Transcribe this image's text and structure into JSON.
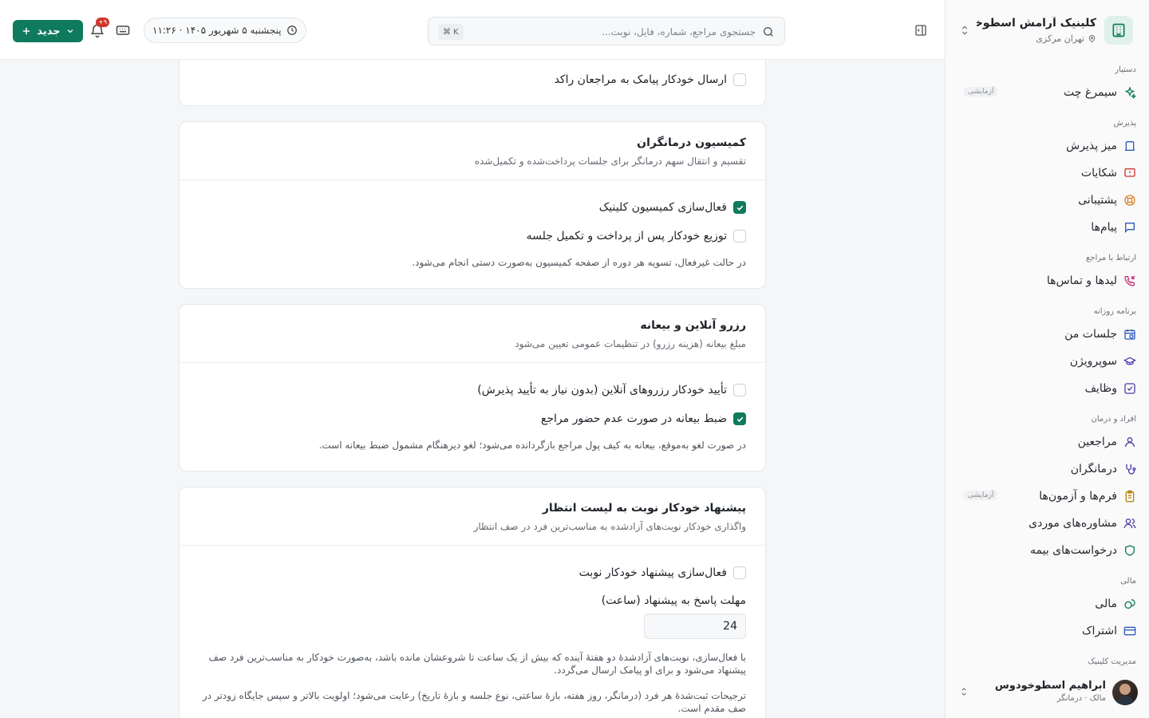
{
  "sidebar": {
    "brand_name": "کلینیک آرامش اسطوخو...",
    "brand_location": "تهران مرکزی",
    "groups": {
      "assistant": "دستیار",
      "reception": "پذیرش",
      "client_contact": "ارتباط با مراجع",
      "daily": "برنامه روزانه",
      "people": "افراد و درمان",
      "finance": "مالی",
      "clinic": "مدیریت کلینیک"
    },
    "items": {
      "simorgh": "سیمرغ چت",
      "reception_desk": "میز پذیرش",
      "complaints": "شکایات",
      "support": "پشتیبانی",
      "messages": "پیام‌ها",
      "leads": "لیدها و تماس‌ها",
      "my_sessions": "جلسات من",
      "supervision": "سوپرویژن",
      "tasks": "وظایف",
      "clients": "مراجعین",
      "therapists": "درمانگران",
      "forms": "فرم‌ها و آزمون‌ها",
      "case_consult": "مشاوره‌های موردی",
      "insurance": "درخواست‌های بیمه",
      "finance": "مالی",
      "subscription": "اشتراک"
    },
    "beta_label": "آزمایشی",
    "user": {
      "name": "ابراهیم اسطوخودوس",
      "role": "مالک · درمانگر"
    }
  },
  "topbar": {
    "search_placeholder": "جستجوی مراجع، شماره، فایل، نوبت...",
    "search_shortcut": "⌘ K",
    "date": "پنجشنبه ۵ شهریور ۱۴۰۵ · ۱۱:۲۶",
    "notifications_count": "۹+",
    "new_label": "جدید"
  },
  "cards": {
    "sms": {
      "label": "ارسال خودکار پیامک به مراجعان راکد",
      "checked": false
    },
    "commission": {
      "title": "کمیسیون درمانگران",
      "subtitle": "تقسیم و انتقال سهم درمانگر برای جلسات پرداخت‌شده و تکمیل‌شده",
      "opt1": "فعال‌سازی کمیسیون کلینیک",
      "opt2": "توزیع خودکار پس از پرداخت و تکمیل جلسه",
      "note": "در حالت غیرفعال، تسویه هر دوره از صفحه کمیسیون به‌صورت دستی انجام می‌شود."
    },
    "booking": {
      "title": "رزرو آنلاین و بیعانه",
      "subtitle": "مبلغ بیعانه (هزینه رزرو) در تنظیمات عمومی تعیین می‌شود",
      "opt1": "تأیید خودکار رزروهای آنلاین (بدون نیاز به تأیید پذیرش)",
      "opt2": "ضبط بیعانه در صورت عدم حضور مراجع",
      "note": "در صورت لغو به‌موقع، بیعانه به کیف پول مراجع بازگردانده می‌شود؛ لغو دیرهنگام مشمول ضبط بیعانه است."
    },
    "waitlist": {
      "title": "پیشنهاد خودکار نوبت به لیست انتظار",
      "subtitle": "واگذاری خودکار نوبت‌های آزادشده به مناسب‌ترین فرد در صف انتظار",
      "opt1": "فعال‌سازی پیشنهاد خودکار نوبت",
      "field_label": "مهلت پاسخ به پیشنهاد (ساعت)",
      "field_value": "24",
      "note1": "با فعال‌سازی، نوبت‌های آزادشدهٔ دو هفتهٔ آینده که بیش از یک ساعت تا شروعشان مانده باشد، به‌صورت خودکار به مناسب‌ترین فرد صف پیشنهاد می‌شود و برای او پیامک ارسال می‌گردد.",
      "note2": "ترجیحات ثبت‌شدهٔ هر فرد (درمانگر، روز هفته، بازهٔ ساعتی، نوع جلسه و بازهٔ تاریخ) رعایت می‌شود؛ اولویت بالاتر و سپس جایگاه زودتر در صف مقدم است."
    }
  },
  "colors": {
    "accent": "#0f7a5c",
    "danger": "#d0342c"
  }
}
